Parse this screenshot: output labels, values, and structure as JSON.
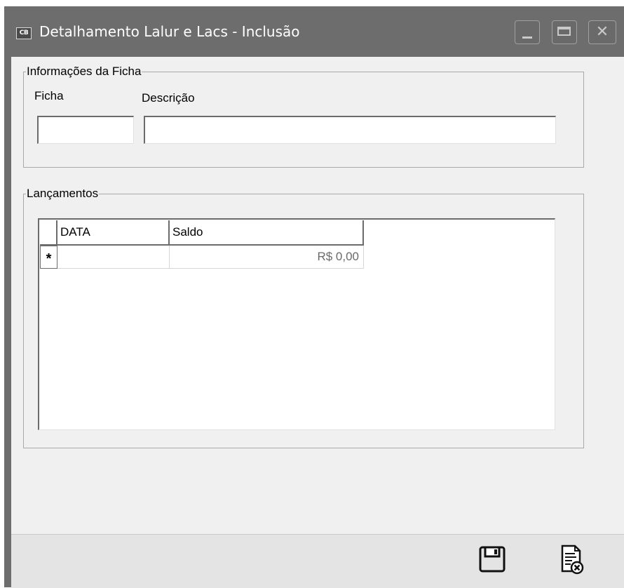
{
  "window": {
    "icon_text": "CB",
    "title": "Detalhamento Lalur e Lacs - Inclusão"
  },
  "informacoes": {
    "legend": "Informações da Ficha",
    "ficha_label": "Ficha",
    "ficha_value": "",
    "descricao_label": "Descrição",
    "descricao_value": ""
  },
  "lancamentos": {
    "legend": "Lançamentos",
    "columns": [
      "DATA",
      "Saldo"
    ],
    "new_row": {
      "indicator": "*",
      "data": "",
      "saldo": "R$ 0,00"
    }
  },
  "toolbar": {
    "save_icon": "save-icon",
    "cancel_icon": "cancel-document-icon"
  },
  "colors": {
    "titlebar": "#6d6d6d",
    "client": "#f0f0f0",
    "footer": "#e4e4e4",
    "saldo_text": "#6a6a6a"
  }
}
